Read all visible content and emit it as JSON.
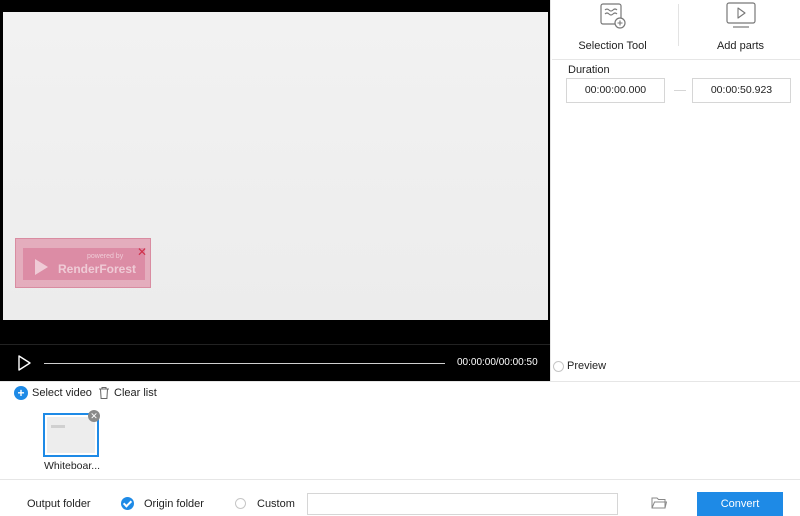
{
  "player": {
    "time_readout": "00:00:00/00:00:50",
    "watermark_powered": "powered by",
    "watermark_brand": "RenderForest"
  },
  "tools": {
    "selection_tool": "Selection Tool",
    "add_parts": "Add parts"
  },
  "duration": {
    "label": "Duration",
    "start": "00:00:00.000",
    "end": "00:00:50.923"
  },
  "preview": {
    "label": "Preview"
  },
  "list": {
    "select_video": "Select video",
    "clear_list": "Clear list",
    "items": [
      {
        "name": "Whiteboar..."
      }
    ]
  },
  "output": {
    "label": "Output folder",
    "origin_folder": "Origin folder",
    "custom": "Custom",
    "path_value": "",
    "convert": "Convert"
  },
  "colors": {
    "accent": "#1e8ae6",
    "watermark": "#dc7896"
  }
}
